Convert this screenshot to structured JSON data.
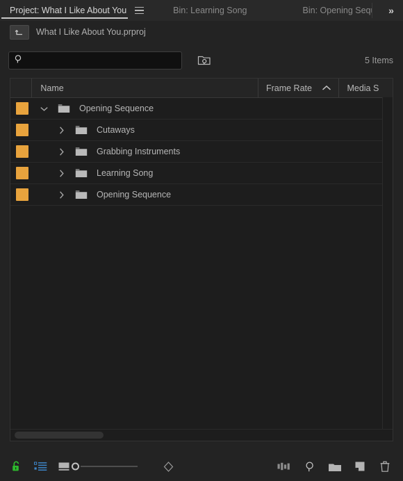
{
  "tabs": [
    {
      "label": "Project: What I Like About You",
      "active": true
    },
    {
      "label": "Bin: Learning Song",
      "active": false
    },
    {
      "label": "Bin: Opening Sequ",
      "active": false
    }
  ],
  "tab_overflow_icon": "double-chevron-right",
  "panel_menu_icon": "hamburger-menu-icon",
  "project": {
    "navigate_up_icon": "navigate-up-icon",
    "file_name": "What I Like About You.prproj"
  },
  "search": {
    "icon": "search-icon",
    "value": "",
    "placeholder": "",
    "find_in_bin_icon": "find-in-bin-icon"
  },
  "item_count": "5 Items",
  "columns": [
    {
      "label": "",
      "key": "swatch"
    },
    {
      "label": "Name",
      "key": "name"
    },
    {
      "label": "Frame Rate",
      "key": "frame_rate",
      "sorted": "asc",
      "sort_icon": "chevron-up-icon"
    },
    {
      "label": "Media S",
      "key": "media_start"
    }
  ],
  "rows": [
    {
      "label": "Opening Sequence",
      "label_color": "#e8a33d",
      "expanded": true,
      "disclosure_icon": "chevron-down-icon",
      "folder_icon": "bin-folder-icon",
      "indent": 0,
      "frame_rate": "",
      "media_start": ""
    },
    {
      "label": "Cutaways",
      "label_color": "#e8a33d",
      "expanded": false,
      "disclosure_icon": "chevron-right-icon",
      "folder_icon": "bin-folder-icon",
      "indent": 1,
      "frame_rate": "",
      "media_start": ""
    },
    {
      "label": "Grabbing Instruments",
      "label_color": "#e8a33d",
      "expanded": false,
      "disclosure_icon": "chevron-right-icon",
      "folder_icon": "bin-folder-icon",
      "indent": 1,
      "frame_rate": "",
      "media_start": ""
    },
    {
      "label": "Learning Song",
      "label_color": "#e8a33d",
      "expanded": false,
      "disclosure_icon": "chevron-right-icon",
      "folder_icon": "bin-folder-icon",
      "indent": 1,
      "frame_rate": "",
      "media_start": ""
    },
    {
      "label": "Opening Sequence",
      "label_color": "#e8a33d",
      "expanded": false,
      "disclosure_icon": "chevron-right-icon",
      "folder_icon": "bin-folder-icon",
      "indent": 1,
      "frame_rate": "",
      "media_start": ""
    }
  ],
  "toolbar": {
    "lock_icon": "unlocked-padlock-icon",
    "lock_color": "#2eb82e",
    "list_view_icon": "list-view-icon",
    "list_view_color": "#3d85c8",
    "icon_view_icon": "icon-view-icon",
    "zoom_slider_label": "zoom-slider",
    "zoom_slider_value": 0,
    "sort_icon": "sort-diamond-icon",
    "freeform_view_icon": "freeform-view-icon",
    "find_icon": "find-icon",
    "new_bin_icon": "new-bin-icon",
    "new_item_icon": "new-item-icon",
    "delete_icon": "trash-icon"
  },
  "scrollbars": {
    "horizontal_thumb": "horizontal-scrollbar-thumb"
  }
}
